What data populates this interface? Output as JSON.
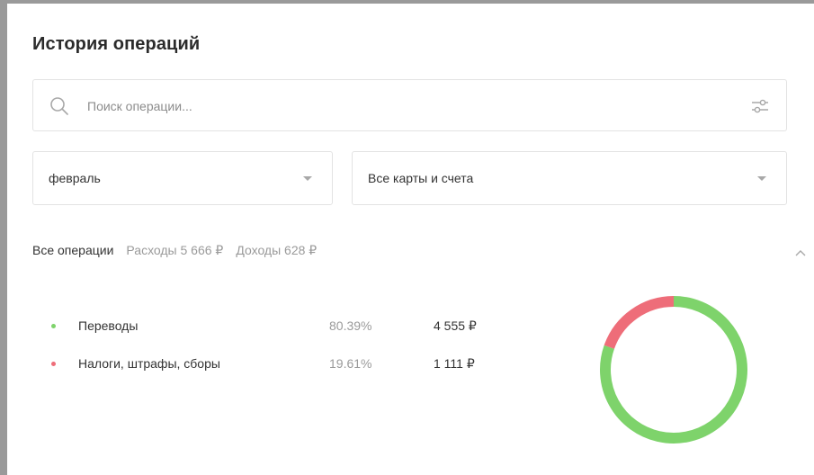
{
  "header": {
    "title": "История операций"
  },
  "search": {
    "placeholder": "Поиск операции..."
  },
  "filters": {
    "month": {
      "value": "февраль"
    },
    "account": {
      "value": "Все карты и счета"
    }
  },
  "summary": {
    "all_label": "Все операции",
    "expenses": "Расходы 5 666 ₽",
    "income": "Доходы 628 ₽"
  },
  "categories": [
    {
      "name": "Переводы",
      "percent": "80.39%",
      "amount": "4 555 ₽",
      "color": "#7ed36b",
      "fraction": 0.8039
    },
    {
      "name": "Налоги, штрафы, сборы",
      "percent": "19.61%",
      "amount": "1 111 ₽",
      "color": "#ee6d79",
      "fraction": 0.1961
    }
  ],
  "icons": {
    "search": "search-icon",
    "filter": "sliders-icon",
    "dropdown": "caret-down-icon",
    "collapse": "chevron-up-icon"
  }
}
